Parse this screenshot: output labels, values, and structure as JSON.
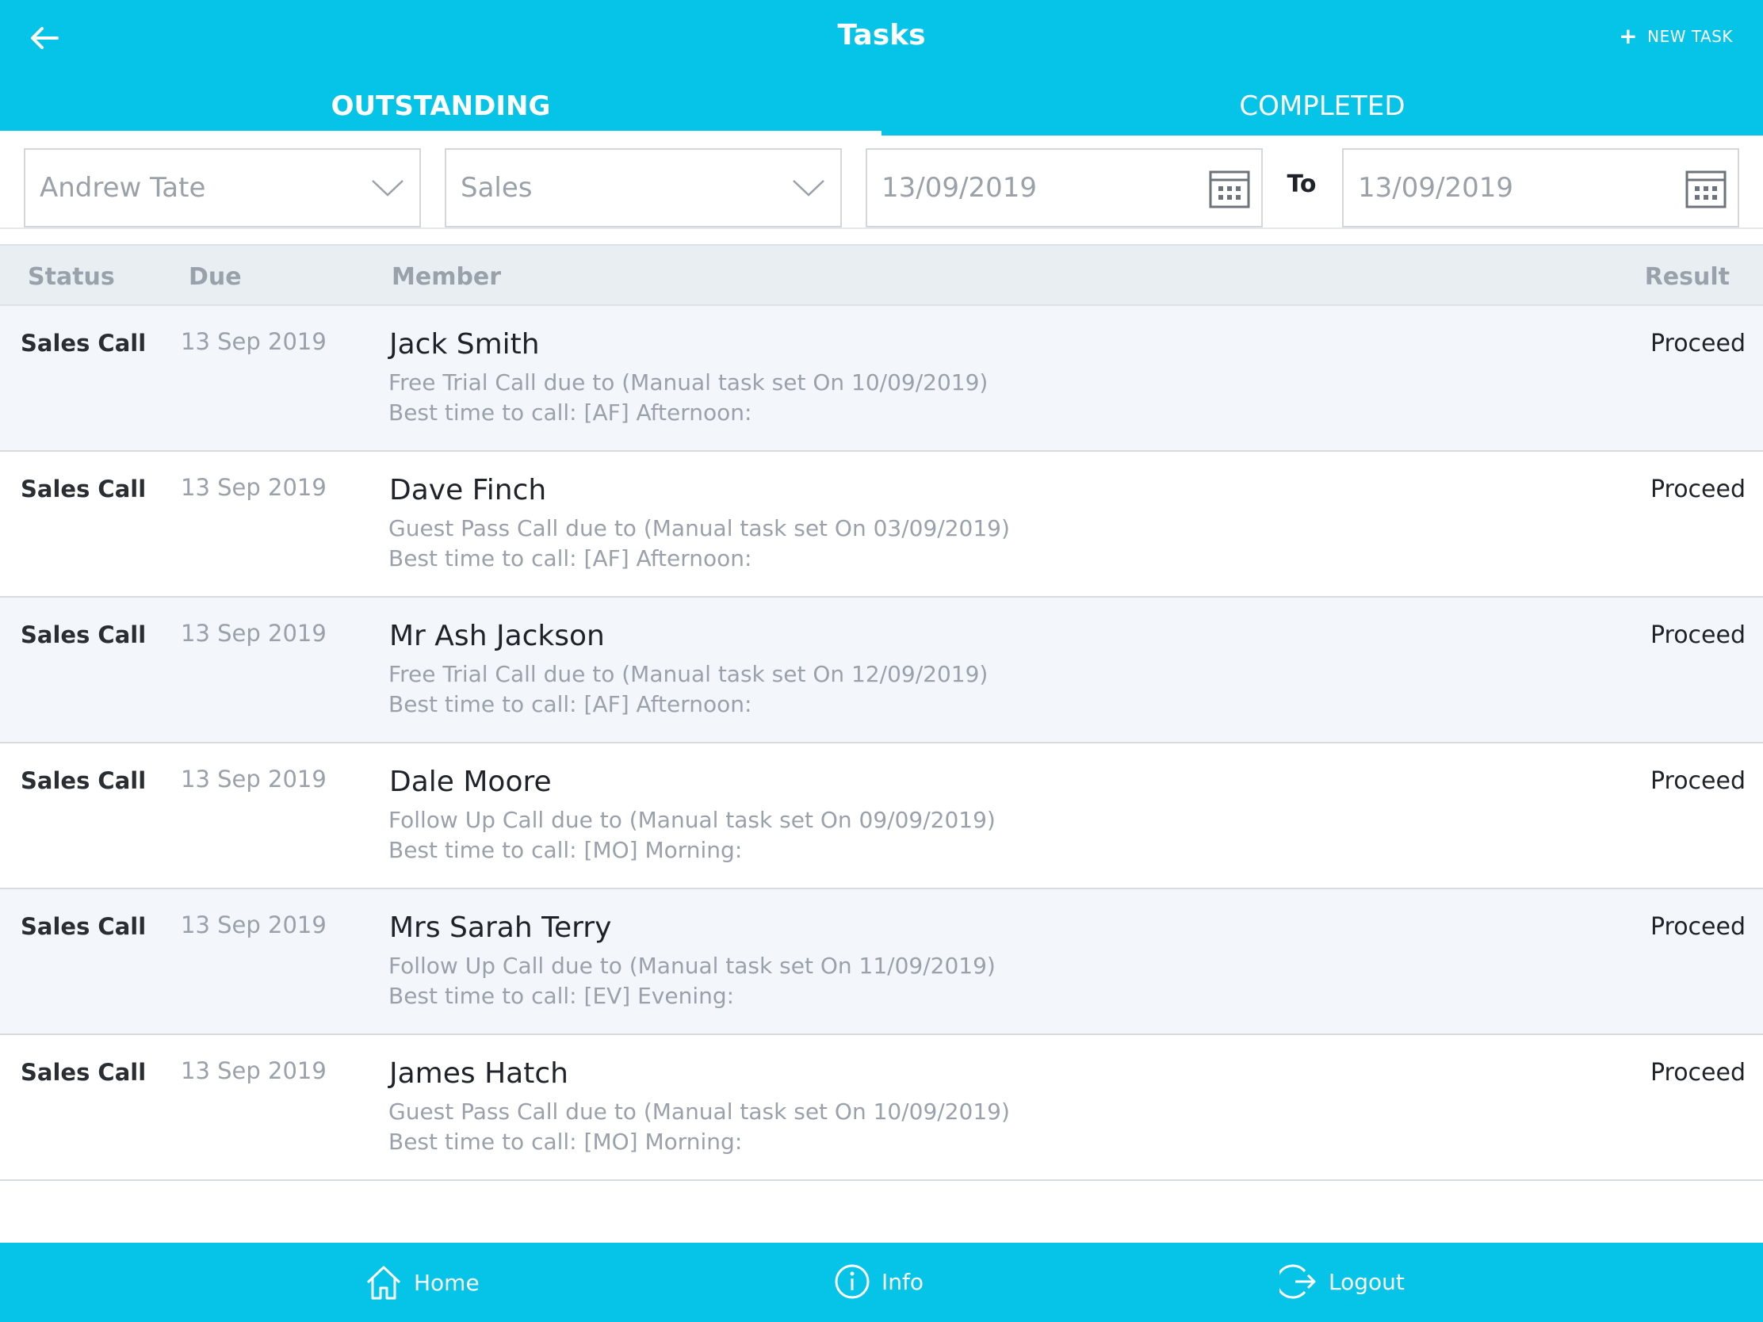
{
  "header": {
    "title": "Tasks",
    "back_icon": "arrow-left-icon",
    "new_task_label": "NEW TASK",
    "new_task_icon": "plus-icon"
  },
  "tabs": [
    {
      "label": "OUTSTANDING",
      "active": true
    },
    {
      "label": "COMPLETED",
      "active": false
    }
  ],
  "filters": {
    "member": "Andrew Tate",
    "type": "Sales",
    "date_from": "13/09/2019",
    "to_label": "To",
    "date_to": "13/09/2019"
  },
  "table": {
    "columns": {
      "status": "Status",
      "due": "Due",
      "member": "Member",
      "result": "Result"
    },
    "rows": [
      {
        "status": "Sales Call",
        "due": "13 Sep 2019",
        "name": "Jack Smith",
        "desc": "Free Trial Call due to (Manual task set On 10/09/2019)",
        "best_time": "Best time to call: [AF] Afternoon:",
        "result": "Proceed"
      },
      {
        "status": "Sales Call",
        "due": "13 Sep 2019",
        "name": "Dave Finch",
        "desc": "Guest Pass Call due to (Manual task set On 03/09/2019)",
        "best_time": "Best time to call: [AF] Afternoon:",
        "result": "Proceed"
      },
      {
        "status": "Sales Call",
        "due": "13 Sep 2019",
        "name": "Mr Ash Jackson",
        "desc": "Free Trial Call due to (Manual task set On 12/09/2019)",
        "best_time": "Best time to call: [AF] Afternoon:",
        "result": "Proceed"
      },
      {
        "status": "Sales Call",
        "due": "13 Sep 2019",
        "name": "Dale Moore",
        "desc": "Follow Up Call due to (Manual task set On 09/09/2019)",
        "best_time": "Best time to call: [MO] Morning:",
        "result": "Proceed"
      },
      {
        "status": "Sales Call",
        "due": "13 Sep 2019",
        "name": "Mrs Sarah Terry",
        "desc": "Follow Up Call due to (Manual task set On 11/09/2019)",
        "best_time": "Best time to call: [EV] Evening:",
        "result": "Proceed"
      },
      {
        "status": "Sales Call",
        "due": "13 Sep 2019",
        "name": "James Hatch",
        "desc": "Guest Pass Call due to (Manual task set On 10/09/2019)",
        "best_time": "Best time to call: [MO] Morning:",
        "result": "Proceed"
      }
    ]
  },
  "footer": {
    "home_label": "Home",
    "info_label": "Info",
    "logout_label": "Logout"
  },
  "colors": {
    "accent": "#05c4e8",
    "row_alt": "#f3f7fb"
  }
}
